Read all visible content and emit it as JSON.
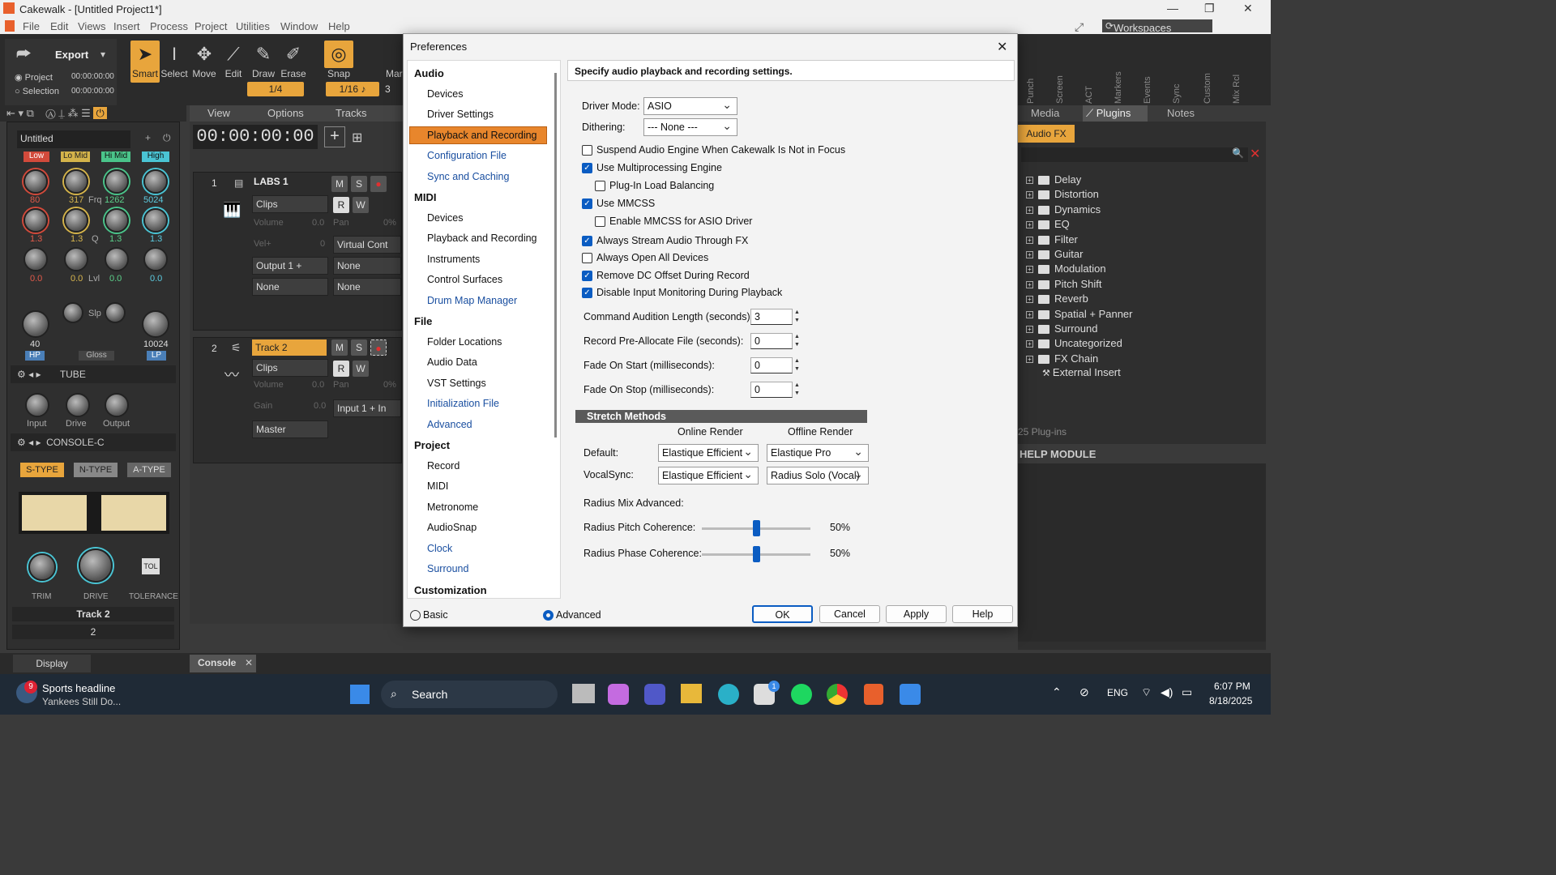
{
  "app": {
    "title": "Cakewalk - [Untitled Project1*]"
  },
  "menu": [
    "File",
    "Edit",
    "Views",
    "Insert",
    "Process",
    "Project",
    "Utilities",
    "Window",
    "Help"
  ],
  "workspaces": "Workspaces",
  "toolbar": {
    "export": "Export",
    "project": "Project",
    "selection": "Selection",
    "time1": "00:00:00:00",
    "time2": "00:00:00:00",
    "tools": [
      "Smart",
      "Select",
      "Move",
      "Edit",
      "Draw",
      "Erase"
    ],
    "snap": "Snap",
    "snap_val": "1/16",
    "fraction": "1/4",
    "marker_partial": "Mar",
    "num3": "3",
    "vertical": [
      "Punch",
      "Screen",
      "ACT",
      "Markers",
      "Events",
      "Sync",
      "Custom",
      "Mix Rcl"
    ]
  },
  "browser": {
    "tabs": [
      "Media",
      "Plugins",
      "Notes"
    ],
    "audiofx": "Audio FX",
    "plugins": [
      "Delay",
      "Distortion",
      "Dynamics",
      "EQ",
      "Filter",
      "Guitar",
      "Modulation",
      "Pitch Shift",
      "Reverb",
      "Spatial + Panner",
      "Surround",
      "Uncategorized",
      "FX Chain"
    ],
    "external": "External Insert",
    "count": "25 Plug-ins",
    "help": "HELP MODULE"
  },
  "strip": {
    "name": "Untitled",
    "bands": [
      "Low",
      "Lo Mid",
      "Hi Mid",
      "High"
    ],
    "freqs": [
      "80",
      "317",
      "1262",
      "5024"
    ],
    "frq": "Frq",
    "q": [
      "1.3",
      "1.3",
      "1.3",
      "1.3"
    ],
    "qlbl": "Q",
    "lvl": [
      "0.0",
      "0.0",
      "0.0",
      "0.0"
    ],
    "lvllbl": "Lvl",
    "slp": "Slp",
    "hp": "40",
    "lp": "10024",
    "hplbl": "HP",
    "gloss": "Gloss",
    "lplbl": "LP",
    "tube": "TUBE",
    "tube_knobs": [
      "Input",
      "Drive",
      "Output"
    ],
    "console": "CONSOLE-C",
    "types": [
      "S-TYPE",
      "N-TYPE",
      "A-TYPE"
    ],
    "console_knobs": [
      "TRIM",
      "DRIVE",
      "TOLERANCE"
    ],
    "tol": "TOL",
    "track": "Track 2",
    "num": "2",
    "display": "Display"
  },
  "tracks": {
    "view": "View",
    "options": "Options",
    "tracks": "Tracks",
    "time": "00:00:00:00",
    "t1": {
      "num": "1",
      "name": "LABS 1",
      "clips": "Clips",
      "volume": "Volume",
      "vol": "0.0",
      "pan": "Pan",
      "panv": "0%",
      "vel": "Vel+",
      "velv": "0",
      "virtual": "Virtual Cont",
      "output": "Output 1 +",
      "none1": "None",
      "none2": "None",
      "none3": "None"
    },
    "t2": {
      "num": "2",
      "name": "Track 2",
      "clips": "Clips",
      "volume": "Volume",
      "vol": "0.0",
      "pan": "Pan",
      "panv": "0%",
      "gain": "Gain",
      "gainv": "0.0",
      "input": "Input 1 + In",
      "master": "Master"
    },
    "mute": "M",
    "solo": "S",
    "read": "R",
    "write": "W",
    "console": "Console"
  },
  "dialog": {
    "title": "Preferences",
    "header": "Specify audio playback and recording settings.",
    "nav": [
      {
        "g": "Audio"
      },
      {
        "i": "Devices"
      },
      {
        "i": "Driver Settings"
      },
      {
        "i": "Playback and Recording",
        "sel": true
      },
      {
        "i": "Configuration File",
        "b": true
      },
      {
        "i": "Sync and Caching",
        "b": true
      },
      {
        "g": "MIDI"
      },
      {
        "i": "Devices"
      },
      {
        "i": "Playback and Recording"
      },
      {
        "i": "Instruments"
      },
      {
        "i": "Control Surfaces"
      },
      {
        "i": "Drum Map Manager",
        "b": true
      },
      {
        "g": "File"
      },
      {
        "i": "Folder Locations"
      },
      {
        "i": "Audio Data"
      },
      {
        "i": "VST Settings"
      },
      {
        "i": "Initialization File",
        "b": true
      },
      {
        "i": "Advanced",
        "b": true
      },
      {
        "g": "Project"
      },
      {
        "i": "Record"
      },
      {
        "i": "MIDI"
      },
      {
        "i": "Metronome"
      },
      {
        "i": "AudioSnap"
      },
      {
        "i": "Clock",
        "b": true
      },
      {
        "i": "Surround",
        "b": true
      },
      {
        "g": "Customization"
      }
    ],
    "driver_mode_lbl": "Driver Mode:",
    "driver_mode": "ASIO",
    "dithering_lbl": "Dithering:",
    "dithering": "--- None ---",
    "options": [
      {
        "t": "Suspend Audio Engine When Cakewalk Is Not in Focus",
        "on": false,
        "ind": 0
      },
      {
        "t": "Use Multiprocessing Engine",
        "on": true,
        "ind": 0
      },
      {
        "t": "Plug-In Load Balancing",
        "on": false,
        "ind": 1
      },
      {
        "t": "Use MMCSS",
        "on": true,
        "ind": 0
      },
      {
        "t": "Enable MMCSS for ASIO Driver",
        "on": false,
        "ind": 1
      },
      {
        "t": "Always Stream Audio Through FX",
        "on": true,
        "ind": 0
      },
      {
        "t": "Always Open All Devices",
        "on": false,
        "ind": 0
      },
      {
        "t": "Remove DC Offset During Record",
        "on": true,
        "ind": 0
      },
      {
        "t": "Disable Input Monitoring During Playback",
        "on": true,
        "ind": 0
      }
    ],
    "spins": [
      {
        "l": "Command Audition Length (seconds):",
        "v": "3"
      },
      {
        "l": "Record Pre-Allocate File (seconds):",
        "v": "0"
      },
      {
        "l": "Fade On Start (milliseconds):",
        "v": "0"
      },
      {
        "l": "Fade On Stop (milliseconds):",
        "v": "0"
      }
    ],
    "stretch": "Stretch Methods",
    "online": "Online Render",
    "offline": "Offline Render",
    "default_lbl": "Default:",
    "default_on": "Elastique Efficient",
    "default_off": "Elastique Pro",
    "vocal_lbl": "VocalSync:",
    "vocal_on": "Elastique Efficient",
    "vocal_off": "Radius Solo (Vocal)",
    "radius_mix": "Radius Mix Advanced:",
    "pitch_lbl": "Radius Pitch Coherence:",
    "pitch_val": "50%",
    "pitch_level": 0.5,
    "phase_lbl": "Radius Phase Coherence:",
    "phase_val": "50%",
    "phase_level": 0.5,
    "basic": "Basic",
    "advanced": "Advanced",
    "ok": "OK",
    "cancel": "Cancel",
    "apply": "Apply",
    "help": "Help"
  },
  "taskbar": {
    "news_badge": "9",
    "news1": "Sports headline",
    "news2": "Yankees Still Do...",
    "search": "Search",
    "lang": "ENG",
    "time": "6:07 PM",
    "date": "8/18/2025",
    "badge": "1"
  }
}
